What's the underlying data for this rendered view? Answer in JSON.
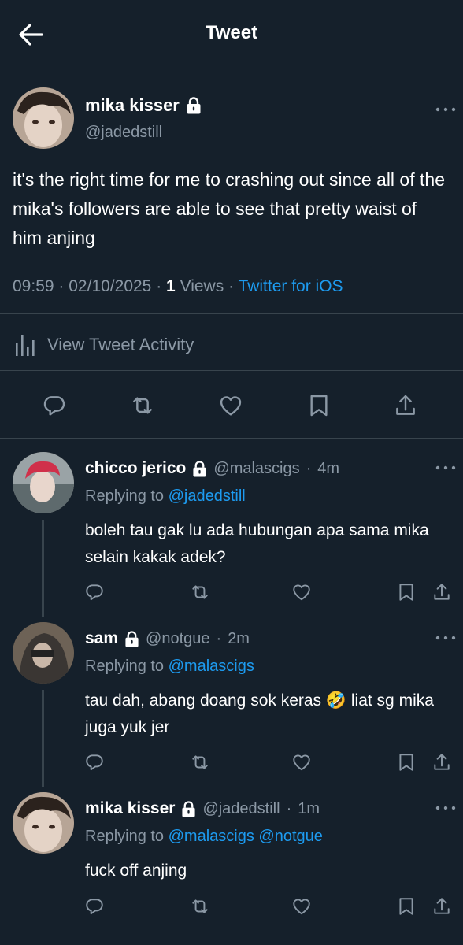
{
  "header": {
    "title": "Tweet",
    "back_icon": "back-arrow-icon"
  },
  "main_tweet": {
    "author_name": "mika kisser",
    "handle": "@jadedstill",
    "text": "it's the right time for me to crashing out since all of the mika's followers are able to see that pretty waist of him anjing",
    "time": "09:59",
    "date": "02/10/2025",
    "views_count": "1",
    "views_label": "Views",
    "source": "Twitter for iOS",
    "activity_label": "View Tweet Activity"
  },
  "replies": [
    {
      "author_name": "chicco jerico",
      "handle": "@malascigs",
      "age": "4m",
      "replying_label": "Replying to",
      "replying_to": "@jadedstill",
      "text": "boleh tau gak lu ada hubungan apa sama mika selain kakak adek?"
    },
    {
      "author_name": "sam",
      "handle": "@notgue",
      "age": "2m",
      "replying_label": "Replying to",
      "replying_to": "@malascigs",
      "text": "tau dah, abang doang sok keras 🤣 liat sg mika juga yuk jer"
    },
    {
      "author_name": "mika kisser",
      "handle": "@jadedstill",
      "age": "1m",
      "replying_label": "Replying to",
      "replying_to": "@malascigs @notgue",
      "text": "fuck off anjing"
    }
  ],
  "separator": "·",
  "colors": {
    "background": "#15202b",
    "muted": "#8b98a5",
    "link": "#1d9bf0",
    "divider": "#38444d"
  }
}
